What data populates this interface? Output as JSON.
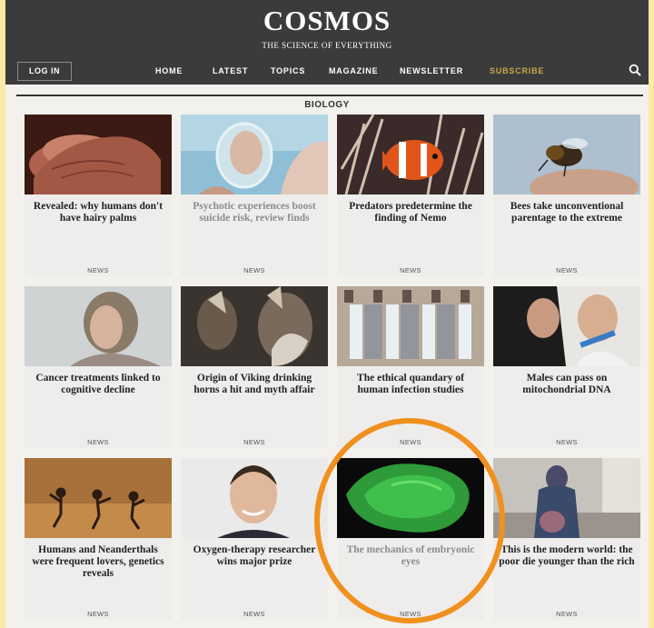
{
  "brand": {
    "logo": "COSMOS",
    "tagline": "THE SCIENCE OF EVERYTHING"
  },
  "header": {
    "login": "LOG IN",
    "nav": [
      "HOME",
      "LATEST",
      "TOPICS",
      "MAGAZINE",
      "NEWSLETTER",
      "SUBSCRIBE"
    ],
    "subscribe_color": "#c8a84a"
  },
  "section": {
    "title": "BIOLOGY"
  },
  "articles": [
    {
      "title": "Revealed: why humans don't have hairy palms",
      "tag": "NEWS",
      "image": "hand-palm"
    },
    {
      "title": "Psychotic experiences boost suicide risk, review finds",
      "tag": "NEWS",
      "image": "mirror-face"
    },
    {
      "title": "Predators predetermine the finding of Nemo",
      "tag": "NEWS",
      "image": "clownfish"
    },
    {
      "title": "Bees take unconventional parentage to the extreme",
      "tag": "NEWS",
      "image": "bee"
    },
    {
      "title": "Cancer treatments linked to cognitive decline",
      "tag": "NEWS",
      "image": "woman-portrait"
    },
    {
      "title": "Origin of Viking drinking horns a hit and myth affair",
      "tag": "NEWS",
      "image": "vikings"
    },
    {
      "title": "The ethical quandary of human infection studies",
      "tag": "NEWS",
      "image": "test-tubes"
    },
    {
      "title": "Males can pass on mitochondrial DNA",
      "tag": "NEWS",
      "image": "mother-child"
    },
    {
      "title": "Humans and Neanderthals were frequent lovers, genetics reveals",
      "tag": "NEWS",
      "image": "dancers"
    },
    {
      "title": "Oxygen-therapy researcher wins major prize",
      "tag": "NEWS",
      "image": "man-portrait"
    },
    {
      "title": "The mechanics of embryonic eyes",
      "tag": "NEWS",
      "image": "green-eye-cup"
    },
    {
      "title": "This is the modern world: the poor die younger than the rich",
      "tag": "NEWS",
      "image": "beggar"
    }
  ],
  "highlight_color": "#f0901e"
}
